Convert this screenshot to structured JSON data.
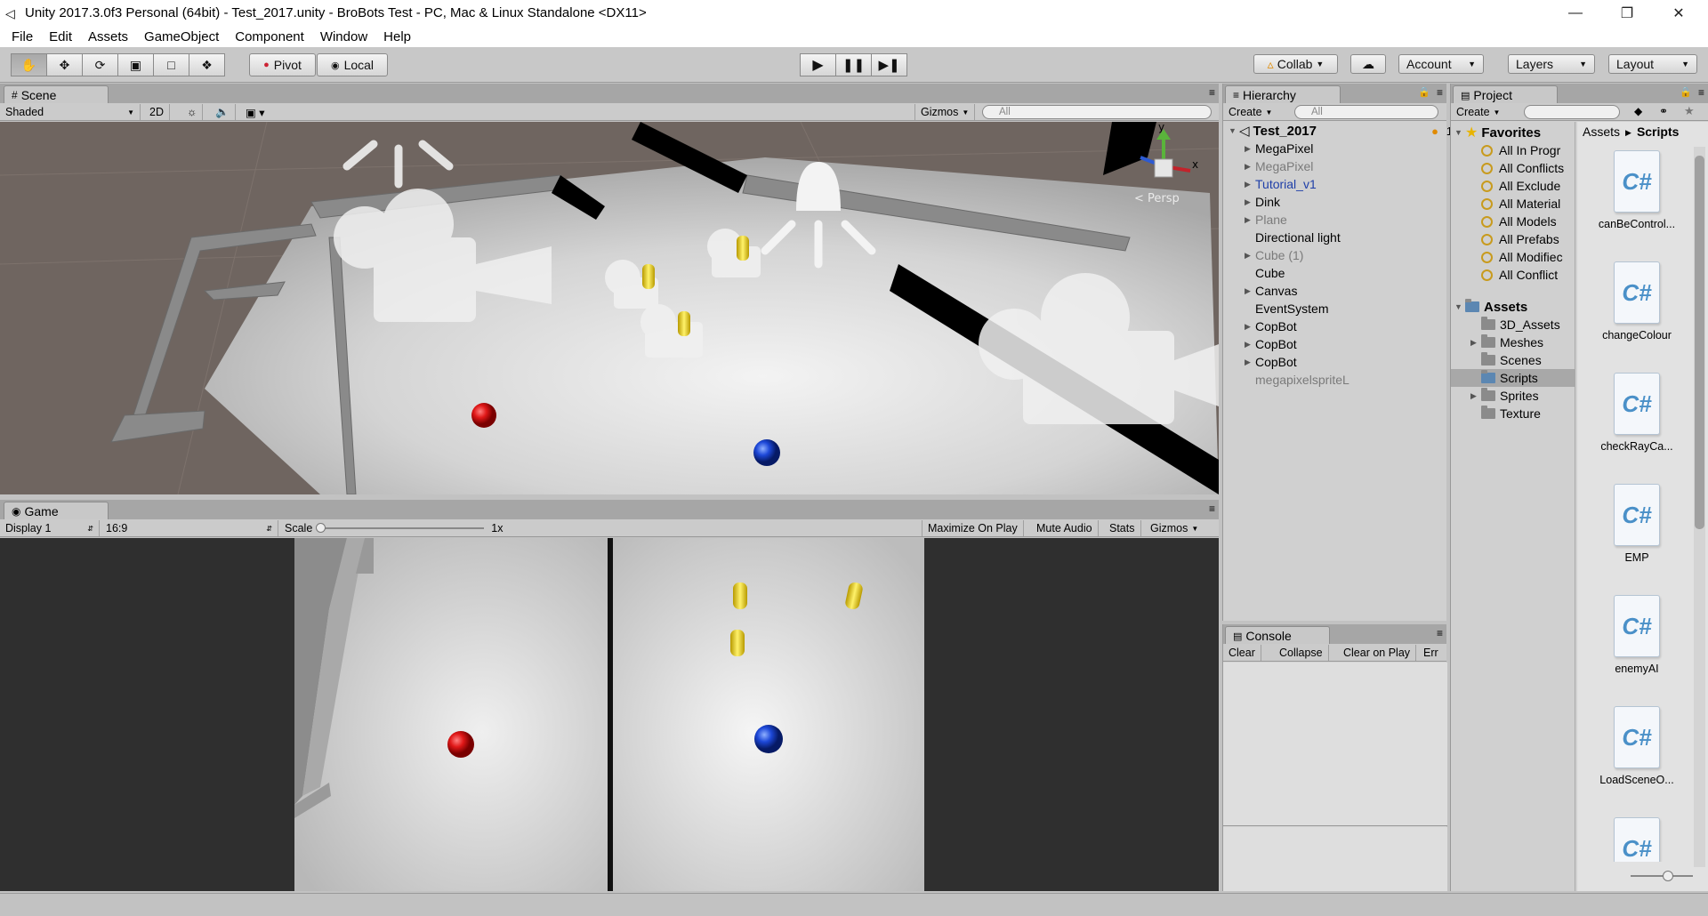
{
  "window": {
    "title": "Unity 2017.3.0f3 Personal (64bit) - Test_2017.unity - BroBots Test - PC, Mac & Linux Standalone <DX11>",
    "icon": "unity-logo-icon",
    "controls": [
      "minimize-icon",
      "restore-icon",
      "close-icon"
    ]
  },
  "menu": [
    "File",
    "Edit",
    "Assets",
    "GameObject",
    "Component",
    "Window",
    "Help"
  ],
  "toolbar": {
    "pivot": "Pivot",
    "local": "Local",
    "collab": "Collab",
    "account": "Account",
    "layers": "Layers",
    "layout": "Layout"
  },
  "scene": {
    "tab": "Scene",
    "shading": "Shaded",
    "mode_2d": "2D",
    "gizmos": "Gizmos",
    "search_placeholder": "All",
    "persp": "Persp"
  },
  "game": {
    "tab": "Game",
    "display": "Display 1",
    "aspect": "16:9",
    "scale_label": "Scale",
    "scale_value": "1x",
    "maximize": "Maximize On Play",
    "mute": "Mute Audio",
    "stats": "Stats",
    "gizmos": "Gizmos"
  },
  "hierarchy": {
    "tab": "Hierarchy",
    "create": "Create",
    "search_placeholder": "All",
    "scene_name": "Test_2017",
    "collab_count": "1",
    "items": [
      {
        "label": "MegaPixel",
        "color": "#000000",
        "arrow": true
      },
      {
        "label": "MegaPixel",
        "color": "#7a7a7a",
        "arrow": true
      },
      {
        "label": "Tutorial_v1",
        "color": "#1f3fa8",
        "arrow": true
      },
      {
        "label": "Dink",
        "color": "#000000",
        "arrow": true
      },
      {
        "label": "Plane",
        "color": "#7a7a7a",
        "arrow": true
      },
      {
        "label": "Directional light",
        "color": "#000000",
        "arrow": false
      },
      {
        "label": "Cube (1)",
        "color": "#7a7a7a",
        "arrow": true
      },
      {
        "label": "Cube",
        "color": "#000000",
        "arrow": false
      },
      {
        "label": "Canvas",
        "color": "#000000",
        "arrow": true
      },
      {
        "label": "EventSystem",
        "color": "#000000",
        "arrow": false
      },
      {
        "label": "CopBot",
        "color": "#000000",
        "arrow": true
      },
      {
        "label": "CopBot",
        "color": "#000000",
        "arrow": true
      },
      {
        "label": "CopBot",
        "color": "#000000",
        "arrow": true
      },
      {
        "label": "megapixelspriteL",
        "color": "#7a7a7a",
        "arrow": false
      }
    ]
  },
  "console": {
    "tab": "Console",
    "clear": "Clear",
    "collapse": "Collapse",
    "clear_on_play": "Clear on Play",
    "error": "Err"
  },
  "project": {
    "tab": "Project",
    "create": "Create",
    "favorites_label": "Favorites",
    "favorites": [
      "All In Progr",
      "All Conflicts",
      "All Exclude",
      "All Material",
      "All Models",
      "All Prefabs",
      "All Modifiec",
      "All Conflict"
    ],
    "assets_label": "Assets",
    "folders": [
      {
        "label": "3D_Assets",
        "arrow": false
      },
      {
        "label": "Meshes",
        "arrow": true
      },
      {
        "label": "Scenes",
        "arrow": false
      },
      {
        "label": "Scripts",
        "arrow": false,
        "selected": true
      },
      {
        "label": "Sprites",
        "arrow": true
      },
      {
        "label": "Texture",
        "arrow": false
      }
    ],
    "breadcrumb": [
      "Assets",
      "Scripts"
    ],
    "assets": [
      "canBeControl...",
      "changeColour",
      "checkRayCa...",
      "EMP",
      "enemyAI",
      "LoadSceneO..."
    ],
    "asset_icon": "C#"
  }
}
